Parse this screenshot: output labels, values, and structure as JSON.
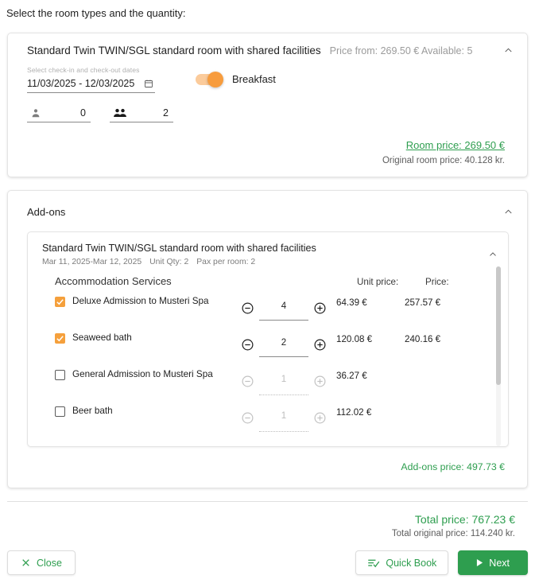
{
  "intro": "Select the room types and the quantity:",
  "room": {
    "title": "Standard Twin TWIN/SGL standard room with shared facilities",
    "meta": "Price from: 269.50 € Available: 5",
    "collapse_icon": "chevron-up-icon",
    "date_label": "Select check-in and check-out dates",
    "date_value": "11/03/2025 - 12/03/2025",
    "calendar_icon": "calendar-icon",
    "breakfast_label": "Breakfast",
    "breakfast_on": true,
    "counters": [
      {
        "icon": "person-icon",
        "value": "0"
      },
      {
        "icon": "people-icon",
        "value": "2"
      }
    ],
    "price_label": "Room price: 269.50 €",
    "original_price_label": "Original room price: 40.128 kr."
  },
  "addons": {
    "title": "Add-ons",
    "collapse_icon": "chevron-up-icon",
    "sub": {
      "title": "Standard Twin TWIN/SGL standard room with shared facilities",
      "dates": "Mar 11, 2025-Mar 12, 2025",
      "unit_qty": "Unit Qty: 2",
      "pax": "Pax per room: 2",
      "collapse_icon": "chevron-up-icon",
      "group_title": "Accommodation Services",
      "col_unit": "Unit price:",
      "col_price": "Price:",
      "rows": [
        {
          "name": "Deluxe Admission to Musteri Spa",
          "checked": true,
          "qty": "4",
          "unit": "64.39 €",
          "price": "257.57 €"
        },
        {
          "name": "Seaweed bath",
          "checked": true,
          "qty": "2",
          "unit": "120.08 €",
          "price": "240.16 €"
        },
        {
          "name": "General Admission to Musteri Spa",
          "checked": false,
          "qty": "1",
          "unit": "36.27 €",
          "price": ""
        },
        {
          "name": "Beer bath",
          "checked": false,
          "qty": "1",
          "unit": "112.02 €",
          "price": ""
        }
      ]
    },
    "total_label": "Add-ons price: 497.73 €"
  },
  "footer": {
    "total_label": "Total price: 767.23 €",
    "total_original_label": "Total original price: 114.240 kr.",
    "close_label": "Close",
    "close_icon": "close-x-icon",
    "quick_book_label": "Quick Book",
    "quick_book_icon": "list-check-icon",
    "next_label": "Next",
    "next_icon": "play-triangle-icon"
  },
  "colors": {
    "green": "#2e9e4f",
    "orange": "#f5a03c",
    "toggle_track": "#fbcb9b",
    "muted": "#9b9b9b"
  }
}
